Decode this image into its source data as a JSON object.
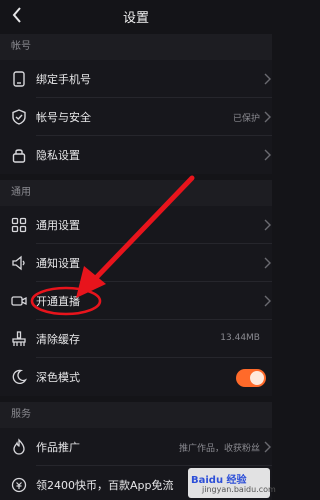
{
  "header": {
    "title": "设置"
  },
  "sections": {
    "account": "帐号",
    "general": "通用",
    "service": "服务"
  },
  "rows": {
    "bind_phone": {
      "label": "绑定手机号",
      "icon": "phone-icon"
    },
    "account_security": {
      "label": "帐号与安全",
      "value": "已保护",
      "icon": "shield-icon"
    },
    "privacy": {
      "label": "隐私设置",
      "icon": "lock-icon"
    },
    "general_settings": {
      "label": "通用设置",
      "icon": "grid-icon"
    },
    "notification": {
      "label": "通知设置",
      "icon": "speaker-icon"
    },
    "live": {
      "label": "开通直播",
      "icon": "video-camera-icon"
    },
    "clear_cache": {
      "label": "清除缓存",
      "value": "13.44MB",
      "icon": "broom-icon"
    },
    "dark_mode": {
      "label": "深色模式",
      "icon": "moon-icon",
      "enabled": true
    },
    "promotion": {
      "label": "作品推广",
      "value": "推广作品，收获粉丝",
      "icon": "flame-icon"
    },
    "coins": {
      "label": "领2400快币，百款App免流",
      "icon": "coin-icon"
    }
  },
  "watermark": {
    "logo": "Baidu 经验",
    "sub": "jingyan.baidu.com"
  },
  "colors": {
    "accent": "#ff6a2a",
    "annotation": "#e8141c",
    "background": "#141418"
  }
}
